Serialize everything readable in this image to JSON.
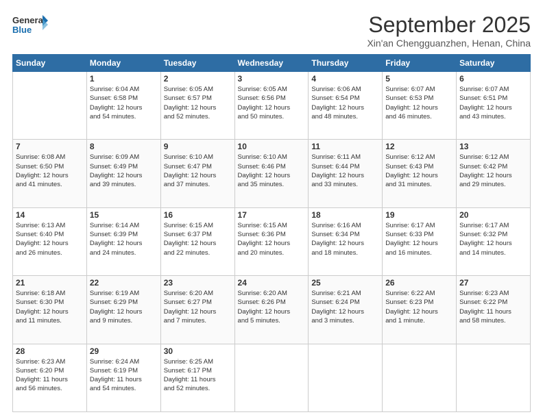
{
  "logo": {
    "line1": "General",
    "line2": "Blue"
  },
  "header": {
    "month": "September 2025",
    "location": "Xin'an Chengguanzhen, Henan, China"
  },
  "weekdays": [
    "Sunday",
    "Monday",
    "Tuesday",
    "Wednesday",
    "Thursday",
    "Friday",
    "Saturday"
  ],
  "weeks": [
    [
      {
        "day": "",
        "detail": ""
      },
      {
        "day": "1",
        "detail": "Sunrise: 6:04 AM\nSunset: 6:58 PM\nDaylight: 12 hours\nand 54 minutes."
      },
      {
        "day": "2",
        "detail": "Sunrise: 6:05 AM\nSunset: 6:57 PM\nDaylight: 12 hours\nand 52 minutes."
      },
      {
        "day": "3",
        "detail": "Sunrise: 6:05 AM\nSunset: 6:56 PM\nDaylight: 12 hours\nand 50 minutes."
      },
      {
        "day": "4",
        "detail": "Sunrise: 6:06 AM\nSunset: 6:54 PM\nDaylight: 12 hours\nand 48 minutes."
      },
      {
        "day": "5",
        "detail": "Sunrise: 6:07 AM\nSunset: 6:53 PM\nDaylight: 12 hours\nand 46 minutes."
      },
      {
        "day": "6",
        "detail": "Sunrise: 6:07 AM\nSunset: 6:51 PM\nDaylight: 12 hours\nand 43 minutes."
      }
    ],
    [
      {
        "day": "7",
        "detail": "Sunrise: 6:08 AM\nSunset: 6:50 PM\nDaylight: 12 hours\nand 41 minutes."
      },
      {
        "day": "8",
        "detail": "Sunrise: 6:09 AM\nSunset: 6:49 PM\nDaylight: 12 hours\nand 39 minutes."
      },
      {
        "day": "9",
        "detail": "Sunrise: 6:10 AM\nSunset: 6:47 PM\nDaylight: 12 hours\nand 37 minutes."
      },
      {
        "day": "10",
        "detail": "Sunrise: 6:10 AM\nSunset: 6:46 PM\nDaylight: 12 hours\nand 35 minutes."
      },
      {
        "day": "11",
        "detail": "Sunrise: 6:11 AM\nSunset: 6:44 PM\nDaylight: 12 hours\nand 33 minutes."
      },
      {
        "day": "12",
        "detail": "Sunrise: 6:12 AM\nSunset: 6:43 PM\nDaylight: 12 hours\nand 31 minutes."
      },
      {
        "day": "13",
        "detail": "Sunrise: 6:12 AM\nSunset: 6:42 PM\nDaylight: 12 hours\nand 29 minutes."
      }
    ],
    [
      {
        "day": "14",
        "detail": "Sunrise: 6:13 AM\nSunset: 6:40 PM\nDaylight: 12 hours\nand 26 minutes."
      },
      {
        "day": "15",
        "detail": "Sunrise: 6:14 AM\nSunset: 6:39 PM\nDaylight: 12 hours\nand 24 minutes."
      },
      {
        "day": "16",
        "detail": "Sunrise: 6:15 AM\nSunset: 6:37 PM\nDaylight: 12 hours\nand 22 minutes."
      },
      {
        "day": "17",
        "detail": "Sunrise: 6:15 AM\nSunset: 6:36 PM\nDaylight: 12 hours\nand 20 minutes."
      },
      {
        "day": "18",
        "detail": "Sunrise: 6:16 AM\nSunset: 6:34 PM\nDaylight: 12 hours\nand 18 minutes."
      },
      {
        "day": "19",
        "detail": "Sunrise: 6:17 AM\nSunset: 6:33 PM\nDaylight: 12 hours\nand 16 minutes."
      },
      {
        "day": "20",
        "detail": "Sunrise: 6:17 AM\nSunset: 6:32 PM\nDaylight: 12 hours\nand 14 minutes."
      }
    ],
    [
      {
        "day": "21",
        "detail": "Sunrise: 6:18 AM\nSunset: 6:30 PM\nDaylight: 12 hours\nand 11 minutes."
      },
      {
        "day": "22",
        "detail": "Sunrise: 6:19 AM\nSunset: 6:29 PM\nDaylight: 12 hours\nand 9 minutes."
      },
      {
        "day": "23",
        "detail": "Sunrise: 6:20 AM\nSunset: 6:27 PM\nDaylight: 12 hours\nand 7 minutes."
      },
      {
        "day": "24",
        "detail": "Sunrise: 6:20 AM\nSunset: 6:26 PM\nDaylight: 12 hours\nand 5 minutes."
      },
      {
        "day": "25",
        "detail": "Sunrise: 6:21 AM\nSunset: 6:24 PM\nDaylight: 12 hours\nand 3 minutes."
      },
      {
        "day": "26",
        "detail": "Sunrise: 6:22 AM\nSunset: 6:23 PM\nDaylight: 12 hours\nand 1 minute."
      },
      {
        "day": "27",
        "detail": "Sunrise: 6:23 AM\nSunset: 6:22 PM\nDaylight: 11 hours\nand 58 minutes."
      }
    ],
    [
      {
        "day": "28",
        "detail": "Sunrise: 6:23 AM\nSunset: 6:20 PM\nDaylight: 11 hours\nand 56 minutes."
      },
      {
        "day": "29",
        "detail": "Sunrise: 6:24 AM\nSunset: 6:19 PM\nDaylight: 11 hours\nand 54 minutes."
      },
      {
        "day": "30",
        "detail": "Sunrise: 6:25 AM\nSunset: 6:17 PM\nDaylight: 11 hours\nand 52 minutes."
      },
      {
        "day": "",
        "detail": ""
      },
      {
        "day": "",
        "detail": ""
      },
      {
        "day": "",
        "detail": ""
      },
      {
        "day": "",
        "detail": ""
      }
    ]
  ]
}
